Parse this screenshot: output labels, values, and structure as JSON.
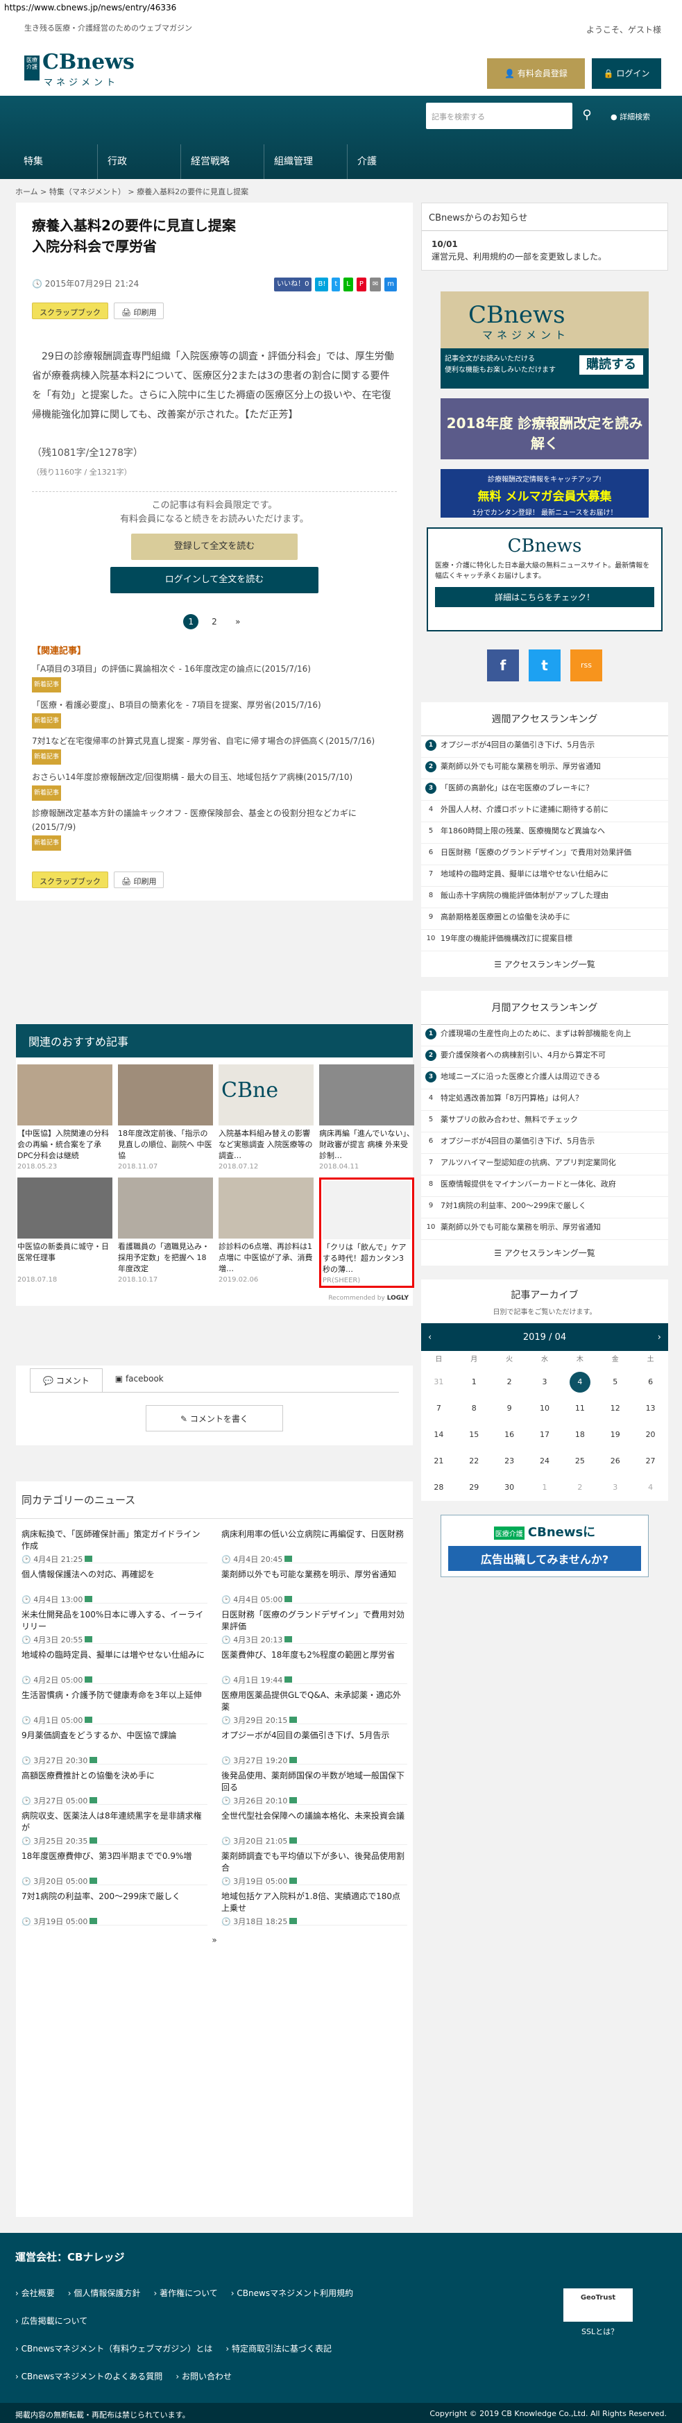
{
  "url": "https://www.cbnews.jp/news/entry/46336",
  "header": {
    "tagline": "生き残る医療・介護経営のためのウェブマガジン",
    "welcome": "ようこそ、ゲスト様",
    "logo_badge": "医療介護",
    "logo_main": "CBnews",
    "logo_sub": "マネジメント",
    "register": "有料会員登録",
    "login": "ログイン"
  },
  "search": {
    "placeholder": "記事を検索する",
    "detail": "詳細検索"
  },
  "nav": [
    "特集",
    "行政",
    "経営戦略",
    "組織管理",
    "介護"
  ],
  "breadcrumb": [
    "ホーム",
    "特集（マネジメント）",
    "療養入基料2の要件に見直し提案"
  ],
  "article": {
    "title": "療養入基料2の要件に見直し提案\n入院分科会で厚労省",
    "date": "2015年07月29日 21:24",
    "share": [
      "いいね！0",
      "B!",
      "t",
      "L",
      "P",
      "✉",
      "m"
    ],
    "scrap": "スクラップブック",
    "print": "印刷用",
    "body": "29日の診療報酬調査専門組織「入院医療等の調査・評価分科会」では、厚生労働省が療養病棟入院基本料2について、医療区分2または3の患者の割合に関する要件を「有効」と提案した。さらに入院中に生じた褥瘡の医療区分上の扱いや、在宅復帰機能強化加算に関しても、改善案が示された。【ただ正芳】",
    "remain": "（残1081字/全1278字）",
    "remain2": "（残り1160字 / 全1321字）",
    "lock1": "この記事は有料会員限定です。",
    "lock2": "有料会員になると続きをお読みいただけます。",
    "btn1": "登録して全文を読む",
    "btn2": "ログインして全文を読む",
    "pages": [
      "1",
      "2",
      "»"
    ]
  },
  "related": {
    "heading": "【関連記事】",
    "new": "新着記事",
    "items": [
      "「A項目の3項目」の評価に異論相次ぐ - 16年度改定の論点に(2015/7/16)",
      "「医療・看護必要度」、B項目の簡素化を - 7項目を提案、厚労省(2015/7/16)",
      "7対1など在宅復帰率の計算式見直し提案 - 厚労省、自宅に帰す場合の評価高く(2015/7/16)",
      "おさらい14年度診療報酬改定/回復期構 - 最大の目玉、地域包括ケア病棟(2015/7/10)",
      "診療報酬改定基本方針の議論キックオフ - 医療保険部会、基金との役割分担などカギに(2015/7/9)"
    ]
  },
  "recommend": {
    "title": "関連のおすすめ記事",
    "recommended_by": "Recommended by",
    "items": [
      {
        "t": "【中医協】入院関連の分科会の再編・統合案を了承 DPC分科会は継続",
        "d": "2018.05.23"
      },
      {
        "t": "18年度改定前後、「指示の見直しの順位、副院へ 中医協",
        "d": "2018.11.07"
      },
      {
        "t": "入院基本料組み替えの影響など実態調査 入院医療等の調査…",
        "d": "2018.07.12"
      },
      {
        "t": "病床再編「進んでいない」、財政審が提言 病棟 外来受診制…",
        "d": "2018.04.11"
      },
      {
        "t": "中医協の新委員に城守・日医常任理事",
        "d": "2018.07.18"
      },
      {
        "t": "看護職員の「適職見込み・採用予定数」を把握へ 18年度改定",
        "d": "2018.10.17"
      },
      {
        "t": "診診料の6点増、再診料は1点増に 中医協が了承、消費増…",
        "d": "2019.02.06"
      },
      {
        "t": "「クリは「飲んで」ケアする時代！超カンタン3秒の薄…",
        "d": "PR(SHEER)"
      }
    ]
  },
  "comments": {
    "tab1": "コメント",
    "tab2": "facebook",
    "btn": "コメントを書く"
  },
  "samecat": {
    "heading": "同カテゴリーのニュース",
    "more": "»",
    "items": [
      {
        "t": "病床転換で、「医師確保計画」策定ガイドライン作成",
        "d": "4月4日 21:25"
      },
      {
        "t": "病床利用率の低い公立病院に再編促す、日医財務",
        "d": "4月4日 20:45"
      },
      {
        "t": "個人情報保護法への対応、再確認を",
        "d": "4月4日 13:00"
      },
      {
        "t": "薬剤師以外でも可能な業務を明示、厚労省通知",
        "d": "4月4日 05:00"
      },
      {
        "t": "米未仕開発品を100%日本に導入する、イーライリリー",
        "d": "4月3日 20:55"
      },
      {
        "t": "日医財務「医療のグランドデザイン」で費用対効果評価",
        "d": "4月3日 20:13"
      },
      {
        "t": "地域枠の臨時定員、擬単には増やせない仕組みに",
        "d": "4月2日 05:00"
      },
      {
        "t": "医薬費伸び、18年度も2%程度の範囲と厚労省",
        "d": "4月1日 19:44"
      },
      {
        "t": "生活習慣病・介護予防で健康寿命を3年以上延伸",
        "d": "4月1日 05:00"
      },
      {
        "t": "医療用医薬品提供GLでQ&A、未承認薬・適応外薬",
        "d": "3月29日 20:15"
      },
      {
        "t": "9月薬価調査をどうするか、中医協で課論",
        "d": "3月27日 20:30"
      },
      {
        "t": "オプジーボが4回目の薬価引き下げ、5月告示",
        "d": "3月27日 19:20"
      },
      {
        "t": "高額医療費推計との協働を決め手に",
        "d": "3月27日 05:00"
      },
      {
        "t": "後発品使用、薬剤師国保の半数が地域一般国保下回る",
        "d": "3月26日 20:10"
      },
      {
        "t": "病院収支、医薬法人は8年連続黒字を是非請求権が",
        "d": "3月25日 20:35"
      },
      {
        "t": "全世代型社会保障への議論本格化、未来投資会議",
        "d": "3月20日 21:05"
      },
      {
        "t": "18年度医療費伸び、第3四半期までで0.9%増",
        "d": "3月20日 05:00"
      },
      {
        "t": "薬剤師調査でも平均値以下が多い、後発品使用割合",
        "d": "3月19日 05:00"
      },
      {
        "t": "7対1病院の利益率、200～299床で厳しく",
        "d": "3月19日 05:00"
      },
      {
        "t": "地域包括ケア入院料が1.8倍、実績適応で180点上乗せ",
        "d": "3月18日 18:25"
      }
    ]
  },
  "sidebar": {
    "notice_head": "CBnewsからのお知らせ",
    "notice_date": "10/01",
    "notice_text": "運営元見、利用規約の一部を変更致しました。",
    "ad1_l1": "記事全文がお読みいただける",
    "ad1_l2": "便利な機能もお楽しみいただけます",
    "ad1_btn": "購読する",
    "ad2": "2018年度 診療報酬改定を読み解く",
    "ad3_top": "診療報酬改定情報をキャッチアップ!",
    "ad3_main": "無料 メルマガ会員大募集",
    "ad3_sub": "1分でカンタン登録！ 最新ニュースをお届け！",
    "ad4_text": "医療・介護に特化した日本最大級の無料ニュースサイト。最新情報を幅広くキャッチ承くお届けします。",
    "ad4_btn": "詳細はこちらをチェック！",
    "social": [
      "f",
      "t",
      "rss"
    ],
    "weekly_head": "週間アクセスランキング",
    "weekly": [
      "オプジーボが4回目の薬価引き下げ、5月告示",
      "薬剤師以外でも可能な業務を明示、厚労省通知",
      "「医師の高齢化」は在宅医療のブレーキに？",
      "外国人人材、介護ロボットに逮捕に期待する前に",
      "年1860時間上限の残業、医療機関など異論なへ",
      "日医財務「医療のグランドデザイン」で費用対効果評価",
      "地域枠の臨時定員、擬単には増やせない仕組みに",
      "飯山赤十字病院の機能評価体制がアップした理由",
      "高齢期格差医療圏との協働を決め手に",
      "19年度の機能評価機構改訂に提案目標"
    ],
    "weekly_more": "アクセスランキング一覧",
    "monthly_head": "月間アクセスランキング",
    "monthly": [
      "介護現場の生産性向上のために、まずは幹部機能を向上",
      "要介護保険者への病棟割引い、4月から算定不可",
      "地域ニーズに沿った医療と介護人は周辺できる",
      "特定処遇改善加算「8万円算格」は何人？",
      "薬サプリの飲み合わせ、無料でチェック",
      "オプジーボが4回目の薬価引き下げ、5月告示",
      "アルツハイマー型認知症の抗病、アプリ判定業同化",
      "医療情報提供をマイナンバーカードと一体化、政府",
      "7対1病院の利益率、200～299床で厳しく",
      "薬剤師以外でも可能な業務を明示、厚労省通知"
    ],
    "monthly_more": "アクセスランキング一覧",
    "arch_head": "記事アーカイブ",
    "arch_sub": "日別で記事をご覧いただけます。",
    "month": "2019 / 04",
    "prev": "‹",
    "next": "›",
    "days": [
      "日",
      "月",
      "火",
      "水",
      "木",
      "金",
      "土"
    ],
    "cal": [
      [
        "31",
        "1",
        "2",
        "3",
        "4",
        "5",
        "6"
      ],
      [
        "7",
        "8",
        "9",
        "10",
        "11",
        "12",
        "13"
      ],
      [
        "14",
        "15",
        "16",
        "17",
        "18",
        "19",
        "20"
      ],
      [
        "21",
        "22",
        "23",
        "24",
        "25",
        "26",
        "27"
      ],
      [
        "28",
        "29",
        "30",
        "1",
        "2",
        "3",
        "4"
      ]
    ],
    "ad5_l1": "医療介護",
    "ad5_l2": "CBnewsに",
    "ad5_l3": "広告出稿してみませんか?"
  },
  "footer": {
    "company": "運営会社：CBナレッジ",
    "links": [
      [
        "会社概要",
        "個人情報保護方針",
        "著作権について",
        "CBnewsマネジメント利用規約"
      ],
      [
        "広告掲載について"
      ],
      [
        "CBnewsマネジメント（有料ウェブマガジン）とは",
        "特定商取引法に基づく表記"
      ],
      [
        "CBnewsマネジメントのよくある質問",
        "お問い合わせ"
      ]
    ],
    "ssl": "SSLとは？",
    "warn": "掲載内容の無断転載・再配布は禁じられています。",
    "copyright": "Copyright © 2019 CB Knowledge Co.,Ltd. All Rights Reserved."
  }
}
